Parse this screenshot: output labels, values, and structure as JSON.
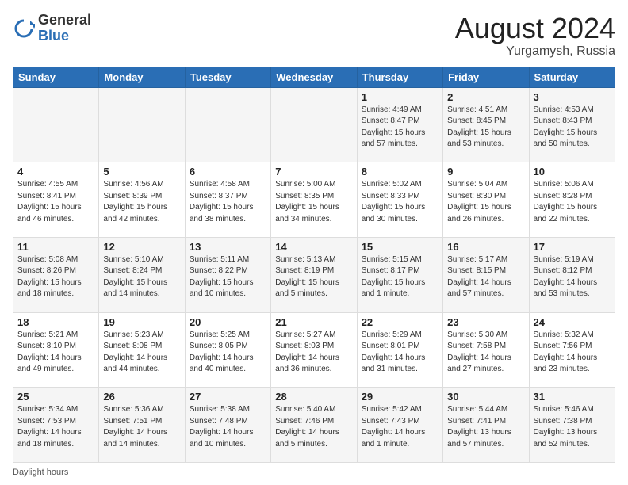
{
  "header": {
    "logo_general": "General",
    "logo_blue": "Blue",
    "month_title": "August 2024",
    "location": "Yurgamysh, Russia"
  },
  "footer": {
    "daylight_label": "Daylight hours"
  },
  "days_of_week": [
    "Sunday",
    "Monday",
    "Tuesday",
    "Wednesday",
    "Thursday",
    "Friday",
    "Saturday"
  ],
  "weeks": [
    [
      {
        "day": "",
        "info": ""
      },
      {
        "day": "",
        "info": ""
      },
      {
        "day": "",
        "info": ""
      },
      {
        "day": "",
        "info": ""
      },
      {
        "day": "1",
        "info": "Sunrise: 4:49 AM\nSunset: 8:47 PM\nDaylight: 15 hours\nand 57 minutes."
      },
      {
        "day": "2",
        "info": "Sunrise: 4:51 AM\nSunset: 8:45 PM\nDaylight: 15 hours\nand 53 minutes."
      },
      {
        "day": "3",
        "info": "Sunrise: 4:53 AM\nSunset: 8:43 PM\nDaylight: 15 hours\nand 50 minutes."
      }
    ],
    [
      {
        "day": "4",
        "info": "Sunrise: 4:55 AM\nSunset: 8:41 PM\nDaylight: 15 hours\nand 46 minutes."
      },
      {
        "day": "5",
        "info": "Sunrise: 4:56 AM\nSunset: 8:39 PM\nDaylight: 15 hours\nand 42 minutes."
      },
      {
        "day": "6",
        "info": "Sunrise: 4:58 AM\nSunset: 8:37 PM\nDaylight: 15 hours\nand 38 minutes."
      },
      {
        "day": "7",
        "info": "Sunrise: 5:00 AM\nSunset: 8:35 PM\nDaylight: 15 hours\nand 34 minutes."
      },
      {
        "day": "8",
        "info": "Sunrise: 5:02 AM\nSunset: 8:33 PM\nDaylight: 15 hours\nand 30 minutes."
      },
      {
        "day": "9",
        "info": "Sunrise: 5:04 AM\nSunset: 8:30 PM\nDaylight: 15 hours\nand 26 minutes."
      },
      {
        "day": "10",
        "info": "Sunrise: 5:06 AM\nSunset: 8:28 PM\nDaylight: 15 hours\nand 22 minutes."
      }
    ],
    [
      {
        "day": "11",
        "info": "Sunrise: 5:08 AM\nSunset: 8:26 PM\nDaylight: 15 hours\nand 18 minutes."
      },
      {
        "day": "12",
        "info": "Sunrise: 5:10 AM\nSunset: 8:24 PM\nDaylight: 15 hours\nand 14 minutes."
      },
      {
        "day": "13",
        "info": "Sunrise: 5:11 AM\nSunset: 8:22 PM\nDaylight: 15 hours\nand 10 minutes."
      },
      {
        "day": "14",
        "info": "Sunrise: 5:13 AM\nSunset: 8:19 PM\nDaylight: 15 hours\nand 5 minutes."
      },
      {
        "day": "15",
        "info": "Sunrise: 5:15 AM\nSunset: 8:17 PM\nDaylight: 15 hours\nand 1 minute."
      },
      {
        "day": "16",
        "info": "Sunrise: 5:17 AM\nSunset: 8:15 PM\nDaylight: 14 hours\nand 57 minutes."
      },
      {
        "day": "17",
        "info": "Sunrise: 5:19 AM\nSunset: 8:12 PM\nDaylight: 14 hours\nand 53 minutes."
      }
    ],
    [
      {
        "day": "18",
        "info": "Sunrise: 5:21 AM\nSunset: 8:10 PM\nDaylight: 14 hours\nand 49 minutes."
      },
      {
        "day": "19",
        "info": "Sunrise: 5:23 AM\nSunset: 8:08 PM\nDaylight: 14 hours\nand 44 minutes."
      },
      {
        "day": "20",
        "info": "Sunrise: 5:25 AM\nSunset: 8:05 PM\nDaylight: 14 hours\nand 40 minutes."
      },
      {
        "day": "21",
        "info": "Sunrise: 5:27 AM\nSunset: 8:03 PM\nDaylight: 14 hours\nand 36 minutes."
      },
      {
        "day": "22",
        "info": "Sunrise: 5:29 AM\nSunset: 8:01 PM\nDaylight: 14 hours\nand 31 minutes."
      },
      {
        "day": "23",
        "info": "Sunrise: 5:30 AM\nSunset: 7:58 PM\nDaylight: 14 hours\nand 27 minutes."
      },
      {
        "day": "24",
        "info": "Sunrise: 5:32 AM\nSunset: 7:56 PM\nDaylight: 14 hours\nand 23 minutes."
      }
    ],
    [
      {
        "day": "25",
        "info": "Sunrise: 5:34 AM\nSunset: 7:53 PM\nDaylight: 14 hours\nand 18 minutes."
      },
      {
        "day": "26",
        "info": "Sunrise: 5:36 AM\nSunset: 7:51 PM\nDaylight: 14 hours\nand 14 minutes."
      },
      {
        "day": "27",
        "info": "Sunrise: 5:38 AM\nSunset: 7:48 PM\nDaylight: 14 hours\nand 10 minutes."
      },
      {
        "day": "28",
        "info": "Sunrise: 5:40 AM\nSunset: 7:46 PM\nDaylight: 14 hours\nand 5 minutes."
      },
      {
        "day": "29",
        "info": "Sunrise: 5:42 AM\nSunset: 7:43 PM\nDaylight: 14 hours\nand 1 minute."
      },
      {
        "day": "30",
        "info": "Sunrise: 5:44 AM\nSunset: 7:41 PM\nDaylight: 13 hours\nand 57 minutes."
      },
      {
        "day": "31",
        "info": "Sunrise: 5:46 AM\nSunset: 7:38 PM\nDaylight: 13 hours\nand 52 minutes."
      }
    ]
  ]
}
